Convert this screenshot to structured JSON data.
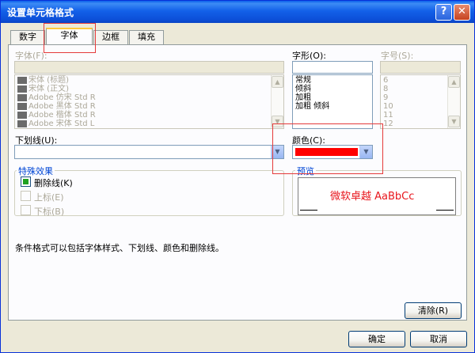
{
  "window": {
    "title": "设置单元格格式",
    "help_glyph": "?",
    "close_glyph": "✕"
  },
  "tabs": [
    {
      "label": "数字",
      "active": false
    },
    {
      "label": "字体",
      "active": true
    },
    {
      "label": "边框",
      "active": false
    },
    {
      "label": "填充",
      "active": false
    }
  ],
  "font": {
    "label": "字体(F):",
    "items": [
      "宋体 (标题)",
      "宋体 (正文)",
      "Adobe 仿宋 Std R",
      "Adobe 黑体 Std R",
      "Adobe 楷体 Std R",
      "Adobe 宋体 Std L"
    ]
  },
  "style": {
    "label": "字形(O):",
    "items": [
      "常规",
      "倾斜",
      "加粗",
      "加粗 倾斜"
    ]
  },
  "size": {
    "label": "字号(S):",
    "items": [
      "6",
      "8",
      "9",
      "10",
      "11",
      "12"
    ]
  },
  "underline": {
    "label": "下划线(U):",
    "value": ""
  },
  "color": {
    "label": "颜色(C):",
    "value_hex": "#ff0000"
  },
  "effects": {
    "title": "特殊效果",
    "strikethrough": {
      "label": "删除线(K)",
      "checked": true
    },
    "superscript": {
      "label": "上标(E)",
      "checked": false
    },
    "subscript": {
      "label": "下标(B)",
      "checked": false
    }
  },
  "preview": {
    "title": "预览",
    "text": "微软卓越  AaBbCc",
    "color": "#e8161d"
  },
  "info_text": "条件格式可以包括字体样式、下划线、颜色和删除线。",
  "buttons": {
    "clear": "清除(R)",
    "ok": "确定",
    "cancel": "取消"
  },
  "colors": {
    "accent": "#0a5fea",
    "highlight": "#e53a3a"
  }
}
